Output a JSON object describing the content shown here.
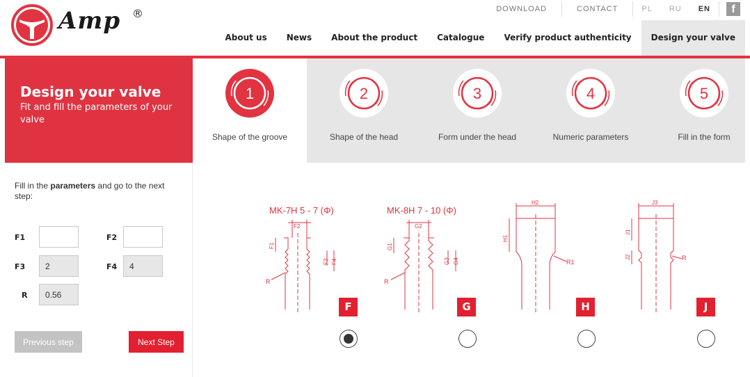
{
  "brand": {
    "name": "Amp",
    "reg": "®",
    "color": "#e23340"
  },
  "topbar": {
    "download": "DOWNLOAD",
    "contact": "CONTACT",
    "langs": [
      "PL",
      "RU",
      "EN"
    ],
    "active_lang": "EN",
    "facebook": "f"
  },
  "nav": [
    "About us",
    "News",
    "About the product",
    "Catalogue",
    "Verify product authenticity",
    "Design your valve"
  ],
  "nav_active": "Design your valve",
  "intro": {
    "title": "Design your valve",
    "subtitle": "Fit and fill the parameters of your valve"
  },
  "steps": [
    {
      "num": "1",
      "label": "Shape of the groove",
      "active": true
    },
    {
      "num": "2",
      "label": "Shape of the head",
      "active": false
    },
    {
      "num": "3",
      "label": "Form under the head",
      "active": false
    },
    {
      "num": "4",
      "label": "Numeric parameters",
      "active": false
    },
    {
      "num": "5",
      "label": "Fill in the form",
      "active": false
    }
  ],
  "form": {
    "hint_pre": "Fill in the ",
    "hint_bold": "parameters",
    "hint_post": " and go to the next step:",
    "fields": [
      {
        "label": "F1",
        "value": ""
      },
      {
        "label": "F2",
        "value": ""
      },
      {
        "label": "F3",
        "value": "2"
      },
      {
        "label": "F4",
        "value": "4"
      },
      {
        "label": "R",
        "value": "0.56"
      }
    ],
    "prev": "Previous step",
    "next": "Next Step"
  },
  "options": [
    {
      "title": "MK-7H  5 - 7 (Φ)",
      "letter": "F",
      "dims": [
        "F2",
        "F1",
        "F3",
        "F4",
        "R"
      ],
      "selected": true
    },
    {
      "title": "MK-8H  7 - 10 (Φ)",
      "letter": "G",
      "dims": [
        "G2",
        "G1",
        "G3",
        "G4",
        "R"
      ],
      "selected": false
    },
    {
      "title": "",
      "letter": "H",
      "dims": [
        "H2",
        "H1",
        "R1"
      ],
      "selected": false
    },
    {
      "title": "",
      "letter": "J",
      "dims": [
        "J3",
        "J1",
        "J2",
        "R"
      ],
      "selected": false
    }
  ]
}
